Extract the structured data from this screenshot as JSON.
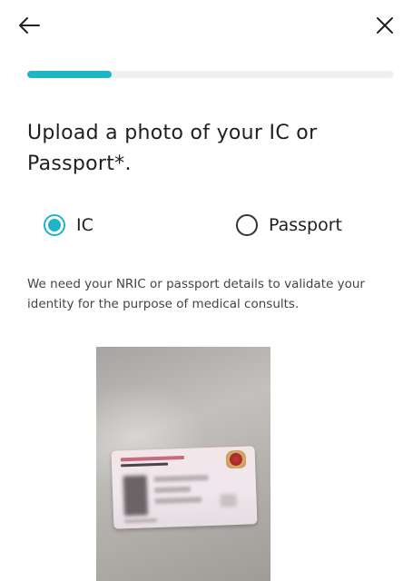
{
  "nav": {
    "back_icon": "arrow-left-icon",
    "close_icon": "close-icon"
  },
  "progress": {
    "fraction": 0.23,
    "color": "#1fb5c8"
  },
  "title": "Upload a photo of your IC or Passport*.",
  "options": {
    "ic": {
      "label": "IC",
      "selected": true
    },
    "passport": {
      "label": "Passport",
      "selected": false
    }
  },
  "description": "We need your NRIC or passport details to validate your identity for the purpose of medical consults.",
  "photo": {
    "card_text_1": "REPUBLIC OF SINGAPORE",
    "card_text_2": "IDENTITY CARD NO."
  },
  "colors": {
    "accent": "#1fb5c8",
    "text": "#1f1f1f"
  }
}
